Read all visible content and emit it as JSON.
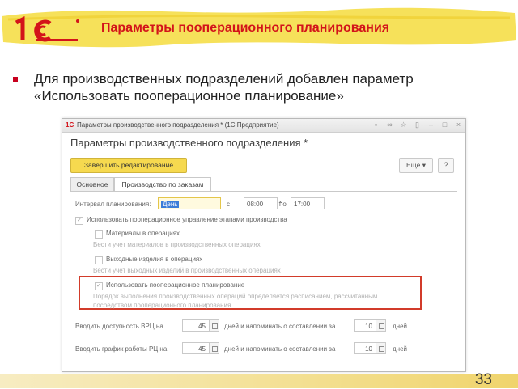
{
  "colors": {
    "accent": "#d3131a",
    "highlight": "#f6d94f",
    "frame": "#d23b2a"
  },
  "slide": {
    "title": "Параметры пооперационного планирования",
    "bullet": "Для производственных подразделений добавлен параметр «Использовать пооперационное планирование»",
    "page_number": "33"
  },
  "window": {
    "logo": "1С",
    "title": "Параметры производственного подразделения * (1С:Предприятие)",
    "controls": [
      "restore-icon",
      "link-icon",
      "star-icon",
      "bookmark-icon",
      "minimize-icon",
      "maximize-icon",
      "close-icon"
    ],
    "form_title": "Параметры производственного подразделения *",
    "finish_button": "Завершить редактирование",
    "more_button": "Еще ▾",
    "help_button": "?",
    "tabs": [
      "Основное",
      "Производство по заказам"
    ],
    "interval_label": "Интервал планирования:",
    "interval_value": "День",
    "from_label": "с",
    "from_value": "08:00",
    "to_label": "по",
    "to_value": "17:00",
    "use_ops_mgmt": "Использовать пооперационное управление этапами производства",
    "materials": "Материалы в операциях",
    "materials_hint": "Вести учет материалов в производственных операциях",
    "outputs": "Выходные изделия в операциях",
    "outputs_hint": "Вести учет выходных изделий в производственных операциях",
    "use_ops_planning": "Использовать пооперационное планирование",
    "planning_hint_1": "Порядок выполнения производственных операций определяется расписанием, рассчитанным",
    "planning_hint_2": "посредством пооперационного планирования",
    "vrc_label": "Вводить доступность ВРЦ на",
    "vrc_value": "45",
    "vrc_mid": "дней и напоминать о составлении за",
    "vrc_remind": "10",
    "vrc_unit": "дней",
    "rc_label": "Вводить график работы РЦ на",
    "rc_value": "45",
    "rc_mid": "дней и напоминать о составлении за",
    "rc_remind": "10",
    "rc_unit": "дней"
  }
}
